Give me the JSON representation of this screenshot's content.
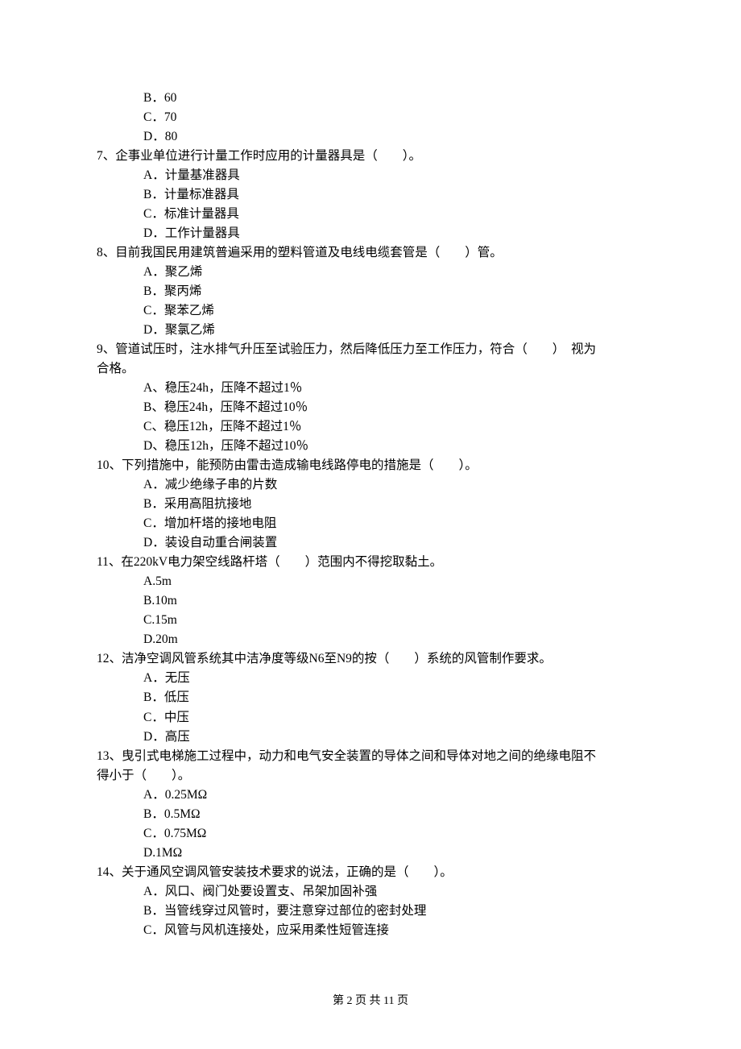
{
  "q6": {
    "options": {
      "B": "B．60",
      "C": "C．70",
      "D": "D．80"
    }
  },
  "q7": {
    "stem": "7、企事业单位进行计量工作时应用的计量器具是（　　）。",
    "options": {
      "A": "A．计量基准器具",
      "B": "B．计量标准器具",
      "C": "C．标准计量器具",
      "D": "D．工作计量器具"
    }
  },
  "q8": {
    "stem": "8、目前我国民用建筑普遍采用的塑料管道及电线电缆套管是（　　）管。",
    "options": {
      "A": "A．聚乙烯",
      "B": "B．聚丙烯",
      "C": "C．聚苯乙烯",
      "D": "D．聚氯乙烯"
    }
  },
  "q9": {
    "stem": "9、管道试压时，注水排气升压至试验压力，然后降低压力至工作压力，符合（　　）　视为",
    "stem_cont": "合格。",
    "options": {
      "A": "A、稳压24h，压降不超过1％",
      "B": "B、稳压24h，压降不超过10％",
      "C": "C、稳压12h，压降不超过1％",
      "D": "D、稳压12h，压降不超过10％"
    }
  },
  "q10": {
    "stem": "10、下列措施中，能预防由雷击造成输电线路停电的措施是（　　）。",
    "options": {
      "A": "A．减少绝缘子串的片数",
      "B": "B．采用高阻抗接地",
      "C": "C．增加杆塔的接地电阻",
      "D": "D．装设自动重合闸装置"
    }
  },
  "q11": {
    "stem": "11、在220kV电力架空线路杆塔（　　）范围内不得挖取黏土。",
    "options": {
      "A": "A.5m",
      "B": "B.10m",
      "C": "C.15m",
      "D": "D.20m"
    }
  },
  "q12": {
    "stem": "12、洁净空调风管系统其中洁净度等级N6至N9的按（　　）系统的风管制作要求。",
    "options": {
      "A": "A．无压",
      "B": "B．低压",
      "C": "C．中压",
      "D": "D．高压"
    }
  },
  "q13": {
    "stem": "13、曳引式电梯施工过程中，动力和电气安全装置的导体之间和导体对地之间的绝缘电阻不",
    "stem_cont": "得小于（　　）。",
    "options": {
      "A": "A．0.25MΩ",
      "B": "B．0.5MΩ",
      "C": "C．0.75MΩ",
      "D": "D.1MΩ"
    }
  },
  "q14": {
    "stem": "14、关于通风空调风管安装技术要求的说法，正确的是（　　）。",
    "options": {
      "A": "A．风口、阀门处要设置支、吊架加固补强",
      "B": "B．当管线穿过风管时，要注意穿过部位的密封处理",
      "C": "C．风管与风机连接处，应采用柔性短管连接"
    }
  },
  "footer": "第 2 页 共 11 页"
}
